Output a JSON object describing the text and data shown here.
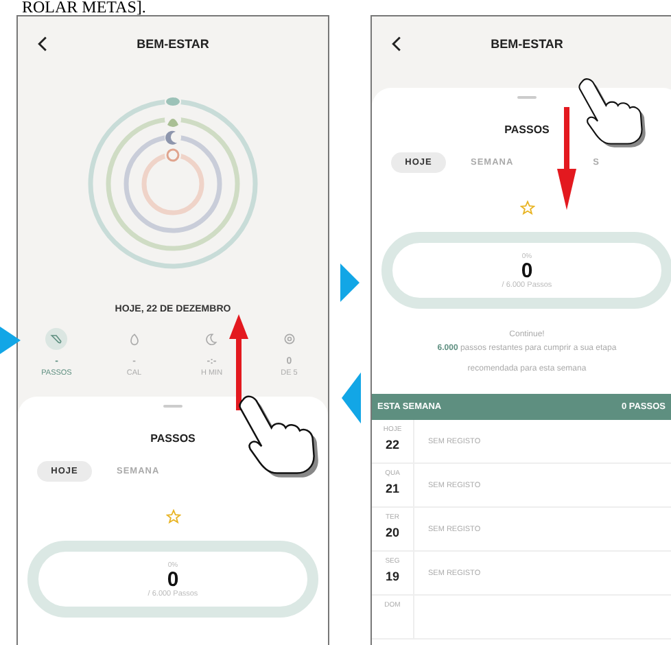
{
  "caption": "ROLAR METAS].",
  "screens": [
    {
      "kind": "overview",
      "gesture": {
        "kind": "up"
      },
      "header": {
        "title": "BEM-ESTAR"
      },
      "date": "HOJE, 22 DE DEZEMBRO",
      "metrics": [
        {
          "kind": "steps",
          "value": "-",
          "label": "PASSOS",
          "selected": true
        },
        {
          "kind": "calories",
          "value": "-",
          "label": "CAL",
          "selected": false
        },
        {
          "kind": "sleep",
          "value": "-:-",
          "label": "H MIN",
          "selected": false
        },
        {
          "kind": "goals",
          "value": "0",
          "label": "DE 5",
          "selected": false
        }
      ],
      "sheet": {
        "title": "PASSOS",
        "tabs": [
          {
            "label": "HOJE",
            "selected": true
          },
          {
            "label": "SEMANA",
            "selected": false
          }
        ],
        "progress": {
          "percent": "0%",
          "value": "0",
          "goal": "/ 6.000 Passos"
        }
      }
    },
    {
      "kind": "detail",
      "gesture": {
        "kind": "down"
      },
      "header": {
        "title": "BEM-ESTAR"
      },
      "sheet": {
        "title": "PASSOS",
        "tabs": [
          {
            "label": "HOJE",
            "selected": true
          },
          {
            "label": "SEMANA",
            "selected": false
          },
          {
            "label": "S",
            "selected": false
          }
        ],
        "progress": {
          "percent": "0%",
          "value": "0",
          "goal": "/ 6.000 Passos"
        },
        "message": {
          "title": "Continue!",
          "text": "**6.000** passos restantes para cumprir a sua etapa recomendada para esta semana"
        },
        "week": {
          "title": "ESTA SEMANA",
          "total": "0 PASSOS",
          "rows": [
            {
              "day": "HOJE",
              "date": "22",
              "status": "SEM REGISTO"
            },
            {
              "day": "QUA",
              "date": "21",
              "status": "SEM REGISTO"
            },
            {
              "day": "TER",
              "date": "20",
              "status": "SEM REGISTO"
            },
            {
              "day": "SEG",
              "date": "19",
              "status": "SEM REGISTO"
            },
            {
              "day": "DOM"
            }
          ]
        }
      }
    }
  ]
}
